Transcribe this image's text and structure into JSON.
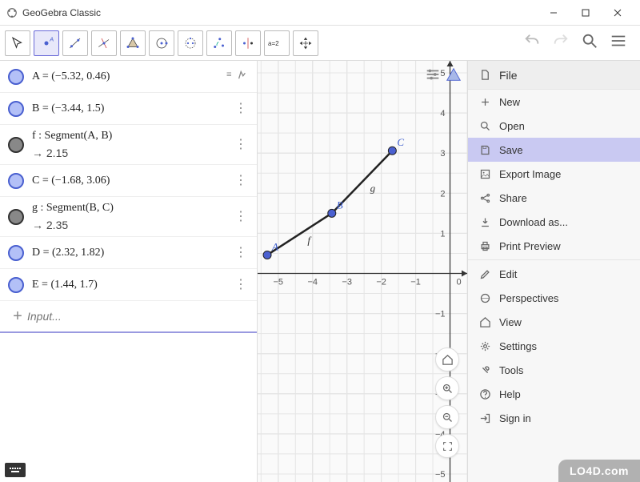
{
  "window": {
    "title": "GeoGebra Classic"
  },
  "toolbar": {
    "tools": [
      "pointer",
      "point",
      "line",
      "perpendicular",
      "polygon",
      "circle",
      "ellipse",
      "angle",
      "reflect",
      "text-a2",
      "move-view"
    ]
  },
  "algebra": {
    "rows": [
      {
        "bullet": "blue",
        "text": "A = (−5.32, 0.46)",
        "first": true
      },
      {
        "bullet": "blue",
        "text": "B = (−3.44, 1.5)"
      },
      {
        "bullet": "dark",
        "text": "f : Segment(A, B)",
        "sub": "→  2.15"
      },
      {
        "bullet": "blue",
        "text": "C = (−1.68, 3.06)"
      },
      {
        "bullet": "dark",
        "text": "g : Segment(B, C)",
        "sub": "→  2.35"
      },
      {
        "bullet": "blue",
        "text": "D = (2.32, 1.82)"
      },
      {
        "bullet": "blue",
        "text": "E = (1.44, 1.7)"
      }
    ],
    "input_placeholder": "Input..."
  },
  "chart_data": {
    "type": "scatter",
    "title": "",
    "xlabel": "",
    "ylabel": "",
    "xlim": [
      -5.6,
      0.5
    ],
    "ylim": [
      -5.2,
      5.3
    ],
    "xticks": [
      -5,
      -4,
      -3,
      -2,
      -1,
      0
    ],
    "yticks": [
      -5,
      -4,
      -3,
      -2,
      -1,
      1,
      2,
      3,
      4,
      5
    ],
    "points": [
      {
        "name": "A",
        "x": -5.32,
        "y": 0.46
      },
      {
        "name": "B",
        "x": -3.44,
        "y": 1.5
      },
      {
        "name": "C",
        "x": -1.68,
        "y": 3.06
      }
    ],
    "segments": [
      {
        "name": "f",
        "from": "A",
        "to": "B",
        "length": 2.15
      },
      {
        "name": "g",
        "from": "B",
        "to": "C",
        "length": 2.35
      }
    ]
  },
  "menu": {
    "header": "File",
    "file_items": [
      {
        "key": "new",
        "label": "New"
      },
      {
        "key": "open",
        "label": "Open"
      },
      {
        "key": "save",
        "label": "Save",
        "hover": true
      },
      {
        "key": "export",
        "label": "Export Image"
      },
      {
        "key": "share",
        "label": "Share"
      },
      {
        "key": "download",
        "label": "Download as..."
      },
      {
        "key": "print",
        "label": "Print Preview"
      }
    ],
    "sections": [
      {
        "key": "edit",
        "label": "Edit"
      },
      {
        "key": "perspectives",
        "label": "Perspectives"
      },
      {
        "key": "view",
        "label": "View"
      },
      {
        "key": "settings",
        "label": "Settings"
      },
      {
        "key": "tools",
        "label": "Tools"
      },
      {
        "key": "help",
        "label": "Help"
      },
      {
        "key": "signin",
        "label": "Sign in"
      }
    ]
  },
  "watermark": "LO4D.com"
}
